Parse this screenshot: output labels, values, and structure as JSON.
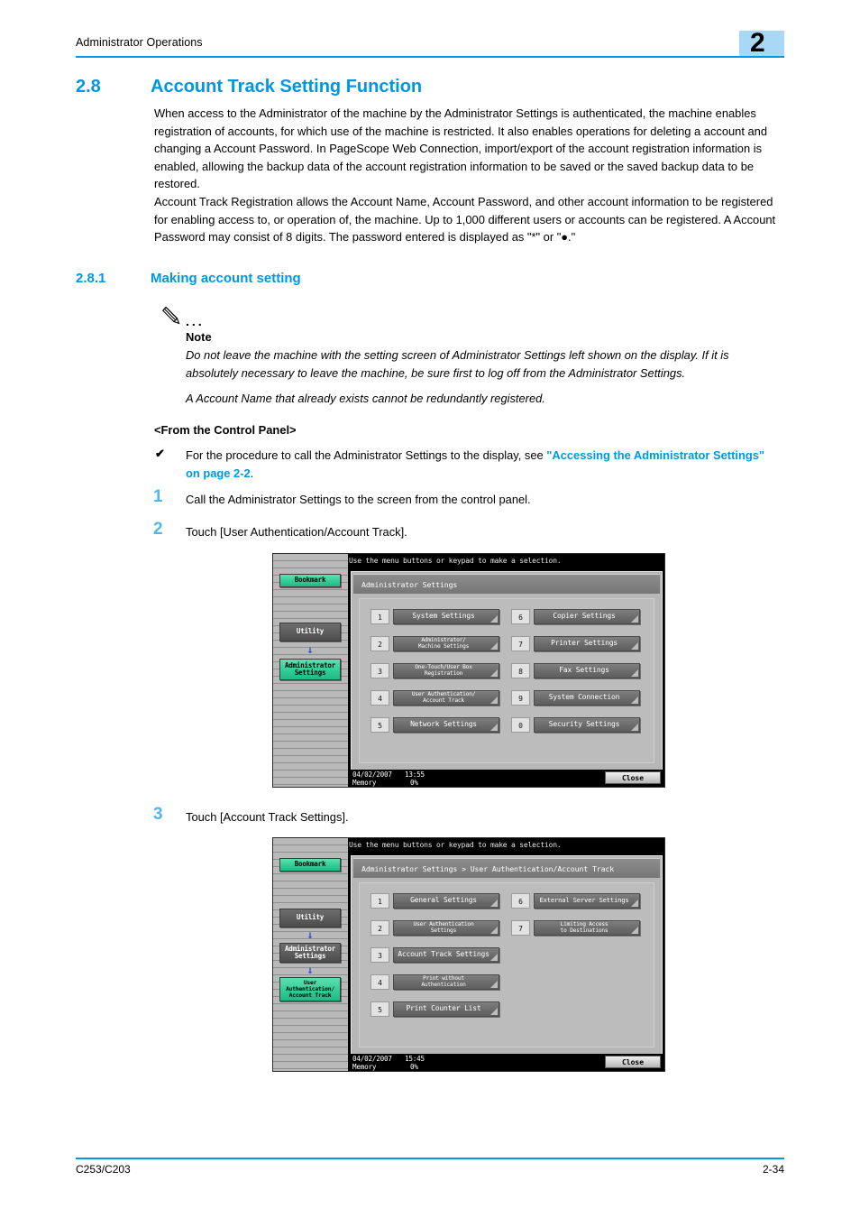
{
  "header": {
    "running_title": "Administrator Operations",
    "chapter_number": "2",
    "accent_color": "#0097e0"
  },
  "section": {
    "number": "2.8",
    "title": "Account Track Setting Function",
    "paragraph1": "When access to the Administrator of the machine by the Administrator Settings is authenticated, the machine enables registration of accounts, for which use of the machine is restricted. It also enables operations for deleting a account and changing a Account Password. In PageScope Web Connection, import/export of the account registration information is enabled, allowing the backup data of the account registration information to be saved or the saved backup data to be restored.",
    "paragraph2": "Account Track Registration allows the Account Name, Account Password, and other account information to be registered for enabling access to, or operation of, the machine. Up to 1,000 different users or accounts can be registered. A Account Password may consist of 8 digits. The password entered is displayed as \"*\" or \"●.\""
  },
  "subsection": {
    "number": "2.8.1",
    "title": "Making account setting"
  },
  "note": {
    "dots": "...",
    "label": "Note",
    "text1": "Do not leave the machine with the setting screen of Administrator Settings left shown on the display. If it is absolutely necessary to leave the machine, be sure first to log off from the Administrator Settings.",
    "text2": "A Account Name that already exists cannot be redundantly registered."
  },
  "procedure": {
    "heading": "<From the Control Panel>",
    "check_mark": "✔",
    "check_text_pre": "For the procedure to call the Administrator Settings to the display, see ",
    "check_link": "\"Accessing the Administrator Settings\" on page 2-2",
    "check_text_post": ".",
    "steps": [
      {
        "num": "1",
        "text": "Call the Administrator Settings to the screen from the control panel."
      },
      {
        "num": "2",
        "text": "Touch [User Authentication/Account Track]."
      },
      {
        "num": "3",
        "text": "Touch [Account Track Settings]."
      }
    ]
  },
  "lcd1": {
    "hint": "Use the menu buttons or keypad to make a selection.",
    "breadcrumb": "Administrator Settings",
    "rail": [
      {
        "label": "Bookmark",
        "style": "green"
      },
      {
        "label": "Utility",
        "style": "dark"
      },
      {
        "label": "Administrator Settings",
        "style": "green"
      }
    ],
    "menu_left": [
      {
        "num": "1",
        "label": "System Settings",
        "lines": 1
      },
      {
        "num": "2",
        "label": "Administrator/\nMachine Settings",
        "lines": 2
      },
      {
        "num": "3",
        "label": "One-Touch/User Box\nRegistration",
        "lines": 2
      },
      {
        "num": "4",
        "label": "User Authentication/\nAccount Track",
        "lines": 2
      },
      {
        "num": "5",
        "label": "Network Settings",
        "lines": 1
      }
    ],
    "menu_right": [
      {
        "num": "6",
        "label": "Copier Settings",
        "lines": 1
      },
      {
        "num": "7",
        "label": "Printer Settings",
        "lines": 1
      },
      {
        "num": "8",
        "label": "Fax Settings",
        "lines": 1
      },
      {
        "num": "9",
        "label": "System Connection",
        "lines": 1
      },
      {
        "num": "0",
        "label": "Security Settings",
        "lines": 1
      }
    ],
    "status": {
      "date": "04/02/2007",
      "time": "13:55",
      "memory_label": "Memory",
      "memory_value": "0%"
    },
    "close_label": "Close"
  },
  "lcd2": {
    "hint": "Use the menu buttons or keypad to make a selection.",
    "breadcrumb": "Administrator Settings > User Authentication/Account Track",
    "rail": [
      {
        "label": "Bookmark",
        "style": "green"
      },
      {
        "label": "Utility",
        "style": "dark"
      },
      {
        "label": "Administrator Settings",
        "style": "dark"
      },
      {
        "label": "User Authentication/ Account Track",
        "style": "green"
      }
    ],
    "menu_left": [
      {
        "num": "1",
        "label": "General Settings",
        "lines": 1
      },
      {
        "num": "2",
        "label": "User Authentication\nSettings",
        "lines": 2
      },
      {
        "num": "3",
        "label": "Account Track Settings",
        "lines": 1
      },
      {
        "num": "4",
        "label": "Print without\nAuthentication",
        "lines": 2
      },
      {
        "num": "5",
        "label": "Print Counter List",
        "lines": 1
      }
    ],
    "menu_right": [
      {
        "num": "6",
        "label": "External Server Settings",
        "lines": 1
      },
      {
        "num": "7",
        "label": "Limiting Access\nto Destinations",
        "lines": 2
      }
    ],
    "status": {
      "date": "04/02/2007",
      "time": "15:45",
      "memory_label": "Memory",
      "memory_value": "0%"
    },
    "close_label": "Close"
  },
  "footer": {
    "left": "C253/C203",
    "right": "2-34"
  }
}
